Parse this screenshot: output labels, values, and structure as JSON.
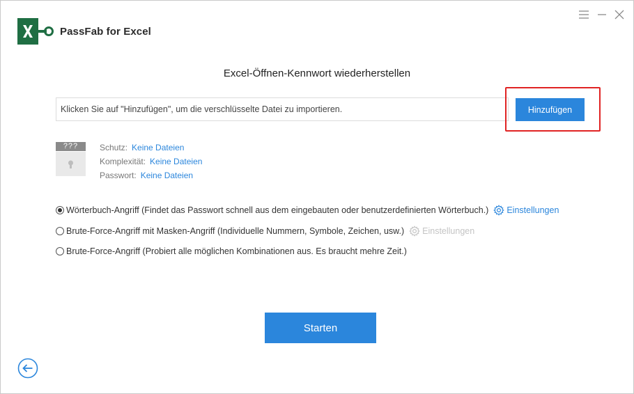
{
  "app": {
    "title": "PassFab for Excel",
    "logo_icon": "excel-key-logo-icon",
    "accent_color": "#2b86dc",
    "logo_color": "#1f6e43"
  },
  "window_controls": {
    "menu_icon": "hamburger-menu-icon",
    "minimize_icon": "minimize-icon",
    "close_icon": "close-icon"
  },
  "main": {
    "title": "Excel-Öffnen-Kennwort wiederherstellen",
    "file_input": {
      "placeholder": "Klicken Sie auf \"Hinzufügen\", um die verschlüsselte Datei zu importieren.",
      "value": ""
    },
    "add_button_label": "Hinzufügen",
    "file_thumb_label": "???",
    "info": {
      "schutz_label": "Schutz:",
      "schutz_value": "Keine Dateien",
      "komplex_label": "Komplexität:",
      "komplex_value": "Keine Dateien",
      "passwort_label": "Passwort:",
      "passwort_value": "Keine Dateien"
    },
    "options": [
      {
        "label": "Wörterbuch-Angriff (Findet das Passwort schnell aus dem eingebauten oder benutzerdefinierten Wörterbuch.)",
        "selected": true,
        "settings_label": "Einstellungen",
        "settings_enabled": true
      },
      {
        "label": "Brute-Force-Angriff mit Masken-Angriff (Individuelle Nummern, Symbole, Zeichen, usw.)",
        "selected": false,
        "settings_label": "Einstellungen",
        "settings_enabled": false
      },
      {
        "label": "Brute-Force-Angriff (Probiert alle möglichen Kombinationen aus. Es braucht mehre Zeit.)",
        "selected": false
      }
    ],
    "start_button_label": "Starten",
    "back_icon": "back-arrow-icon",
    "highlight_color": "#e02323"
  }
}
